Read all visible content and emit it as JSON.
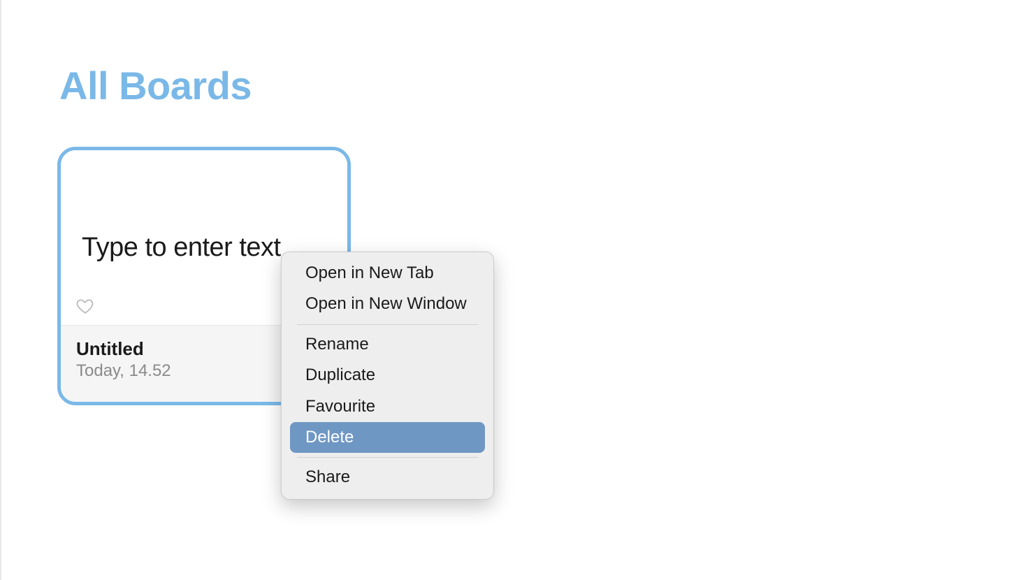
{
  "page": {
    "title": "All Boards"
  },
  "board": {
    "preview_text": "Type to enter text",
    "name": "Untitled",
    "date": "Today, 14.52"
  },
  "context_menu": {
    "items": [
      {
        "label": "Open in New Tab"
      },
      {
        "label": "Open in New Window"
      },
      {
        "label": "Rename"
      },
      {
        "label": "Duplicate"
      },
      {
        "label": "Favourite"
      },
      {
        "label": "Delete",
        "highlighted": true
      },
      {
        "label": "Share"
      }
    ]
  },
  "colors": {
    "accent": "#7ab8e8",
    "menu_highlight": "#6f97c4"
  }
}
